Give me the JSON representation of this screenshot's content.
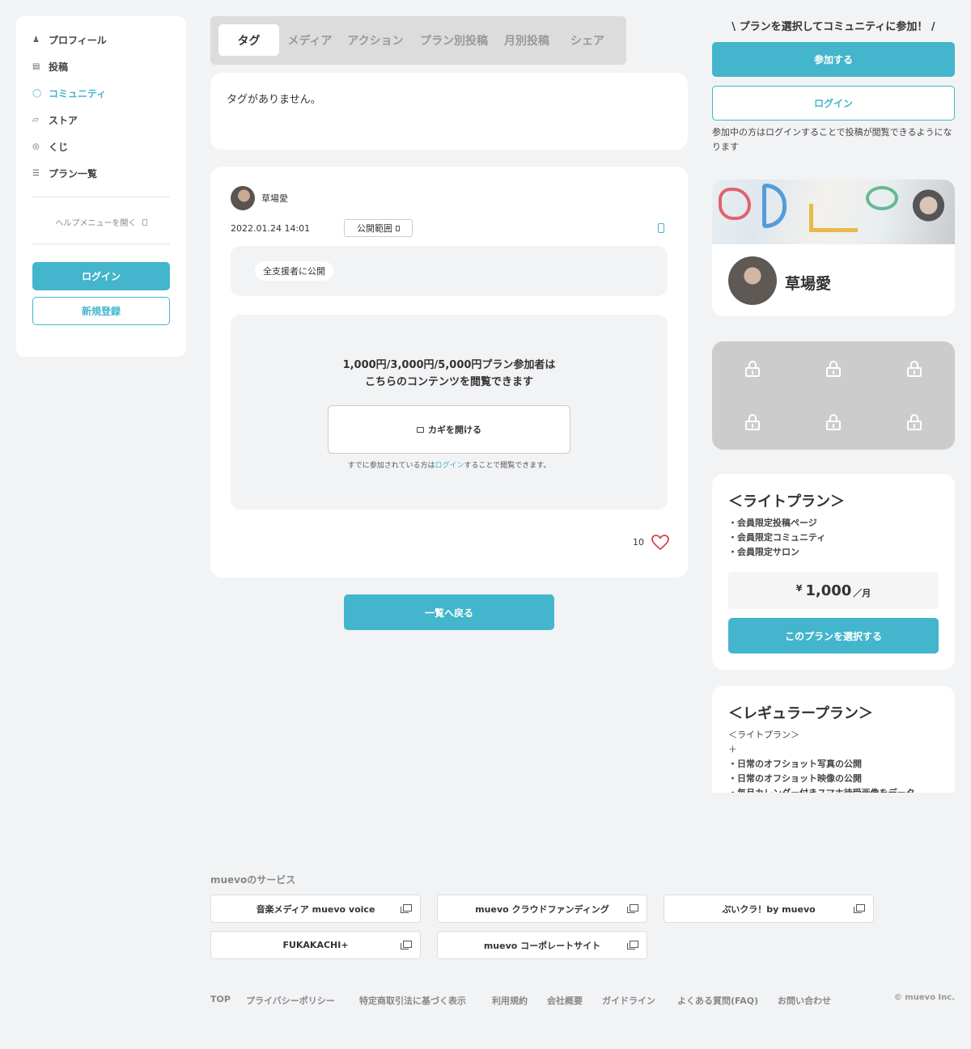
{
  "sidebar": {
    "items": [
      {
        "label": "プロフィール",
        "icon": "person-icon"
      },
      {
        "label": "投稿",
        "icon": "post-icon"
      },
      {
        "label": "コミュニティ",
        "icon": "community-icon",
        "active": true
      },
      {
        "label": "ストア",
        "icon": "store-icon"
      },
      {
        "label": "くじ",
        "icon": "lottery-icon"
      },
      {
        "label": "プラン一覧",
        "icon": "list-icon"
      }
    ],
    "help": "ヘルプメニューを開く",
    "login": "ログイン",
    "register": "新規登録"
  },
  "tabs": [
    "タグ",
    "メディア",
    "アクション",
    "プラン別投稿",
    "月別投稿",
    "シェア"
  ],
  "tags": {
    "empty_text": "タグがありません。"
  },
  "post": {
    "author": "草場愛",
    "date": "2022.01.24 14:01",
    "scope_button": "公開範囲",
    "scope_value": "全支援者に公開",
    "locked_line1": "1,000円/3,000円/5,000円プラン参加者は",
    "locked_line2": "こちらのコンテンツを閲覧できます",
    "unlock_button": "カギを開ける",
    "already_prefix": "すでに参加されている方は",
    "already_link": "ログイン",
    "already_suffix": "することで閲覧できます。",
    "likes": "10"
  },
  "back_button": "一覧へ戻る",
  "right": {
    "cta_header": "\\ プランを選択してコミュニティに参加！ /",
    "join_button": "参加する",
    "login_button": "ログイン",
    "login_note": "参加中の方はログインすることで投稿が閲覧できるようになります",
    "profile_name": "草場愛",
    "light_plan": {
      "title": "＜ライトプラン＞",
      "features": [
        "・会員限定投稿ページ",
        "・会員限定コミュニティ",
        "・会員限定サロン"
      ],
      "currency": "¥",
      "price": "1,000",
      "unit": "／月",
      "select_button": "このプランを選択する"
    },
    "regular_plan": {
      "title": "＜レギュラープラン＞",
      "lines": [
        "＜ライトプラン＞",
        "＋",
        "・日常のオフショット写真の公開",
        "・日常のオフショット映像の公開",
        "・毎月カレンダー付きスマホ待受画像をデータ"
      ]
    }
  },
  "footer": {
    "services_title": "muevoのサービス",
    "services": [
      "音楽メディア muevo voice",
      "muevo クラウドファンディング",
      "ぷいクラ！by muevo",
      "FUKAKACHI+",
      "muevo コーポレートサイト"
    ],
    "links": [
      "TOP",
      "プライバシーポリシー",
      "特定商取引法に基づく表示",
      "利用規約",
      "会社概要",
      "ガイドライン",
      "よくある質問(FAQ)",
      "お問い合わせ"
    ],
    "copyright": "© muevo Inc."
  },
  "colors": {
    "accent": "#43b5cc",
    "background": "#f2f3f5",
    "heart": "#d9434f"
  }
}
